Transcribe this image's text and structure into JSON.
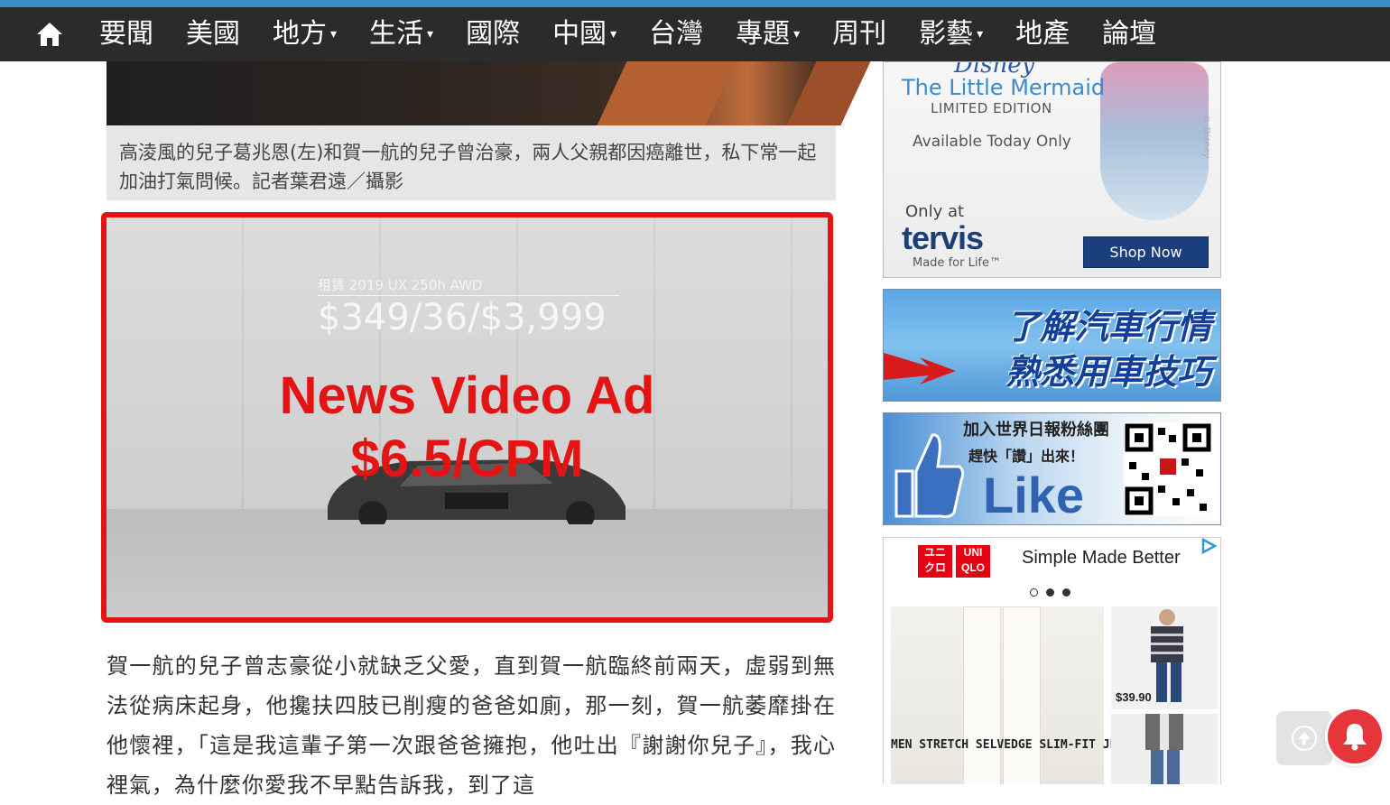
{
  "nav": {
    "items": [
      {
        "label": "要聞",
        "dropdown": false
      },
      {
        "label": "美國",
        "dropdown": false
      },
      {
        "label": "地方",
        "dropdown": true
      },
      {
        "label": "生活",
        "dropdown": true
      },
      {
        "label": "國際",
        "dropdown": false
      },
      {
        "label": "中國",
        "dropdown": true
      },
      {
        "label": "台灣",
        "dropdown": false
      },
      {
        "label": "專題",
        "dropdown": true
      },
      {
        "label": "周刊",
        "dropdown": false
      },
      {
        "label": "影藝",
        "dropdown": true
      },
      {
        "label": "地產",
        "dropdown": false
      },
      {
        "label": "論壇",
        "dropdown": false
      }
    ],
    "caret": "▾",
    "home_icon": "home-icon"
  },
  "photo": {
    "caption": "高淩風的兒子葛兆恩(左)和賀一航的兒子曾治豪，兩人父親都因癌離世，私下常一起加油打氣問候。記者葉君遠／攝影"
  },
  "video_ad": {
    "car_name": "租賃 2019 UX 250h AWD",
    "price_text": "$349/36/$3,999",
    "title": "News Video Ad",
    "cpm": "$6.5/CPM",
    "border_color": "#e51414"
  },
  "article": {
    "text": "賀一航的兒子曾志豪從小就缺乏父愛，直到賀一航臨終前兩天，虛弱到無法從病床起身，他攙扶四肢已削瘦的爸爸如廁，那一刻，賀一航萎靡掛在他懷裡，「這是我這輩子第一次跟爸爸擁抱，他吐出『謝謝你兒子』，我心裡氣，為什麼你愛我不早點告訴我，到了這"
  },
  "sidebar_ads": {
    "tervis": {
      "disney": "Disney",
      "title": "The Little Mermaid",
      "limited": "LIMITED EDITION",
      "available": "Available Today Only",
      "only_at": "Only at",
      "brand": "tervis",
      "made_for_life": "Made for Life™",
      "shop_button": "Shop Now",
      "copyright": "© Disney"
    },
    "car": {
      "line1": "了解汽車行情",
      "line2": "熟悉用車技巧"
    },
    "like": {
      "join": "加入世界日報粉絲團",
      "hurry": "趕快「讚」出來！",
      "word": "Like"
    },
    "uniqlo": {
      "logo_top": "ユニ UNI",
      "logo_a": "ユニ",
      "logo_b": "クロ",
      "logo_c": "UNI",
      "logo_d": "QLO",
      "tagline": "Simple Made Better",
      "jeans_label": "MEN STRETCH SELVEDGE SLIM-FIT JEANS",
      "price": "$39.90"
    }
  },
  "floating": {
    "scroll_top_icon": "arrow-up-icon",
    "bell_icon": "bell-icon"
  }
}
